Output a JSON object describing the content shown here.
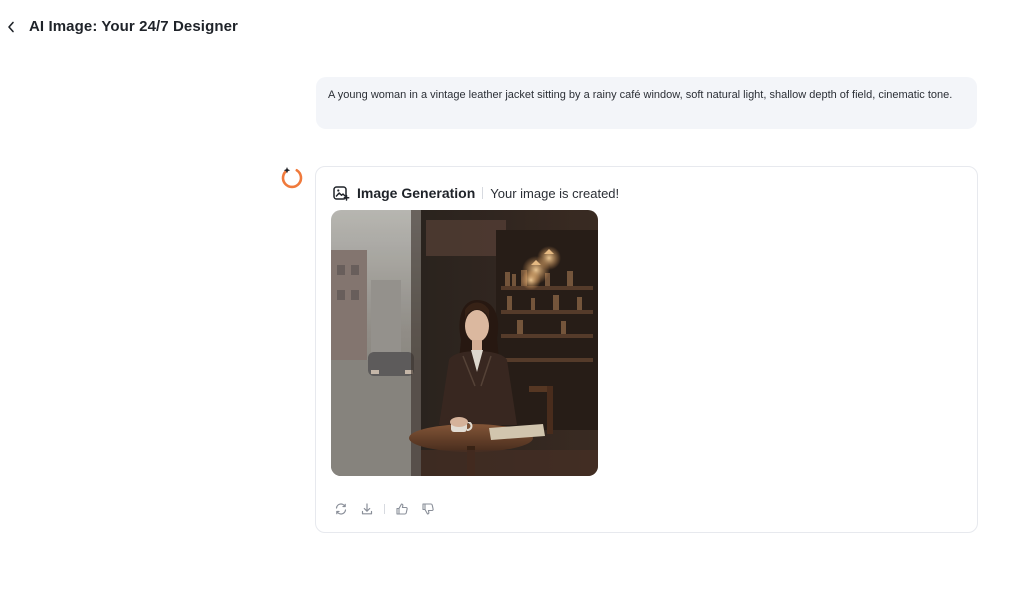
{
  "header": {
    "title": "AI Image: Your 24/7 Designer",
    "back_icon": "chevron-left-icon"
  },
  "conversation": {
    "user_prompt": "A young woman in a vintage leather jacket sitting by a rainy café window, soft natural light, shallow depth of field, cinematic tone.",
    "assistant": {
      "avatar_icon": "assistant-spark-icon",
      "avatar_color": "#f07a3c",
      "tool_icon": "image-generation-icon",
      "tool_name": "Image Generation",
      "status": "Your image is created!",
      "generated_image": "woman-in-cafe-image",
      "actions": [
        {
          "name": "regenerate",
          "icon": "refresh-icon"
        },
        {
          "name": "download",
          "icon": "download-icon"
        },
        {
          "name": "like",
          "icon": "thumbs-up-icon"
        },
        {
          "name": "dislike",
          "icon": "thumbs-down-icon"
        }
      ]
    }
  },
  "colors": {
    "bubble_bg": "#f3f5f9",
    "card_border": "#e7e9ee",
    "text": "#1f2329",
    "icon_gray": "#8a8f99"
  }
}
